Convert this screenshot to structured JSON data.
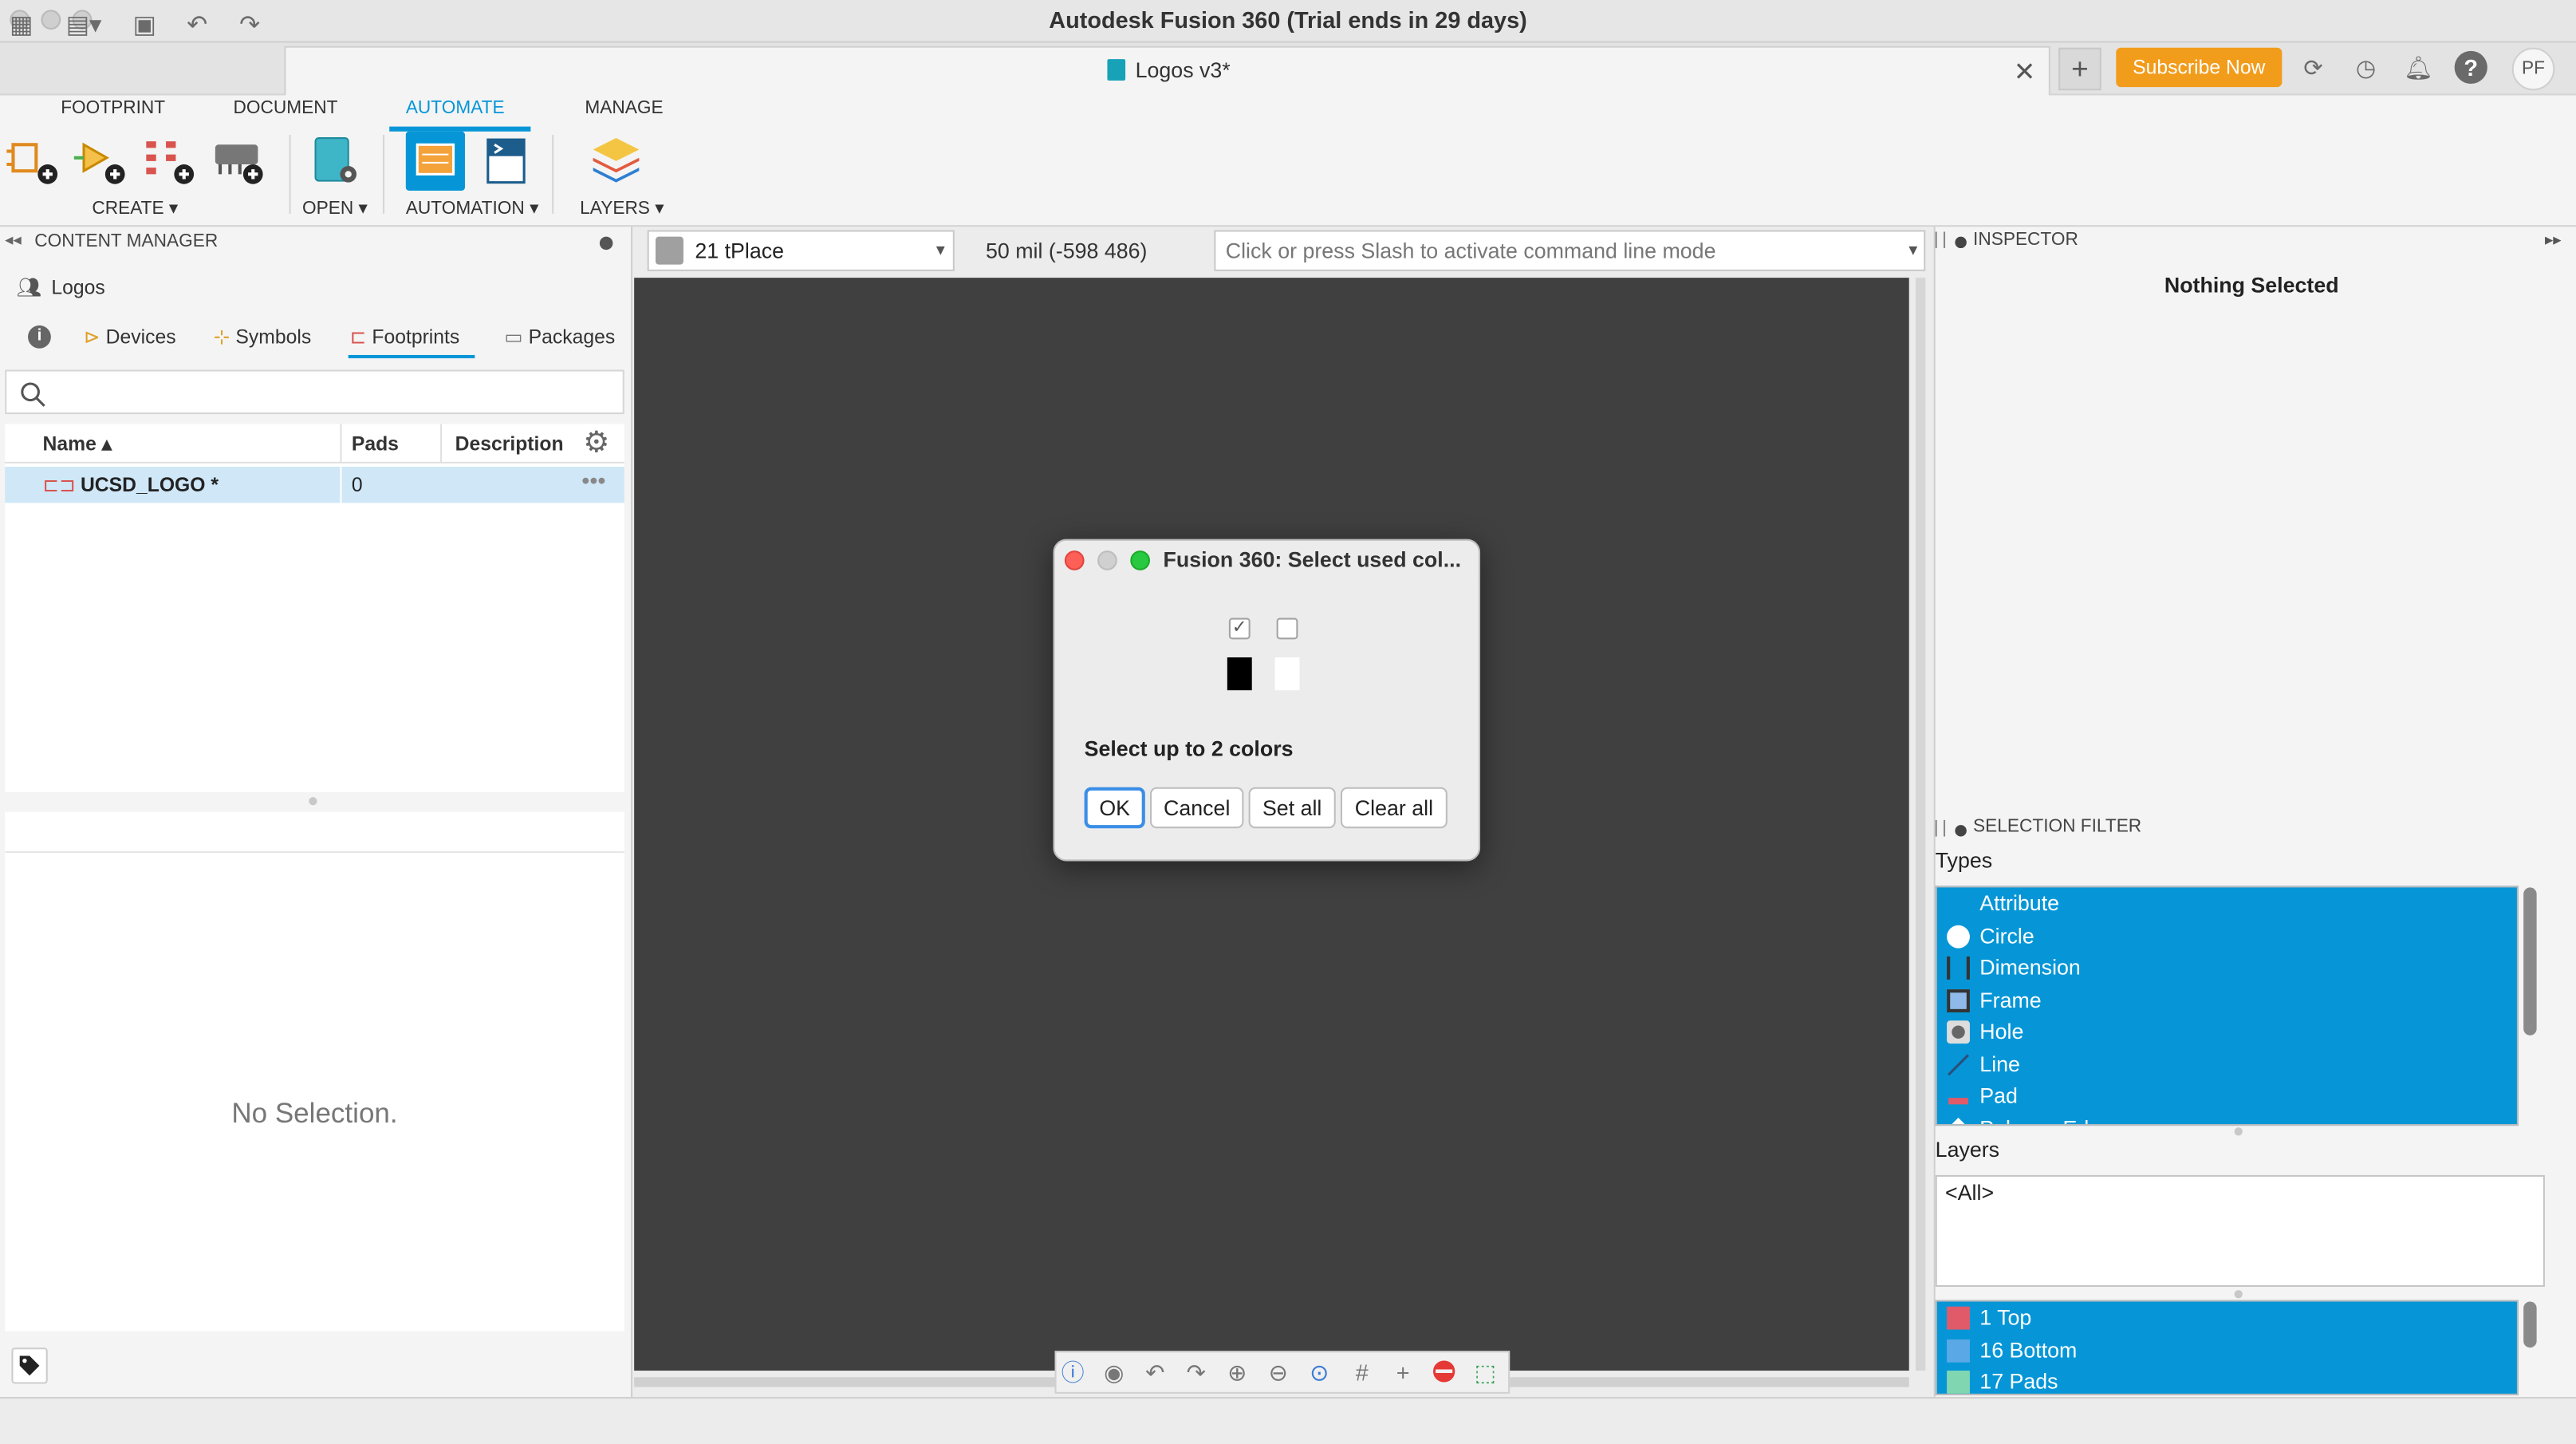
{
  "window": {
    "title": "Autodesk Fusion 360 (Trial ends in 29 days)"
  },
  "tabbar": {
    "document_tab": "Logos v3*",
    "subscribe_label": "Subscribe Now",
    "avatar_initials": "PF"
  },
  "ribbon": {
    "tabs": [
      "FOOTPRINT",
      "DOCUMENT",
      "AUTOMATE",
      "MANAGE"
    ],
    "active_tab": "AUTOMATE",
    "groups": [
      "CREATE ▾",
      "OPEN ▾",
      "AUTOMATION ▾",
      "LAYERS ▾"
    ]
  },
  "content_manager": {
    "header": "CONTENT MANAGER",
    "library": "Logos",
    "tabs": [
      "Devices",
      "Symbols",
      "Footprints",
      "Packages"
    ],
    "active_tab": "Footprints",
    "search_placeholder": "",
    "columns": [
      "Name ▴",
      "Pads",
      "Description"
    ],
    "rows": [
      {
        "name": "UCSD_LOGO *",
        "pads": "0",
        "description": ""
      }
    ],
    "no_selection": "No Selection."
  },
  "canvas_toolbar": {
    "layer": "21 tPlace",
    "layer_color": "#a0a0a0",
    "coordinates": "50 mil (-598 486)",
    "command_placeholder": "Click or press Slash to activate command line mode"
  },
  "dialog": {
    "title": "Fusion 360: Select used col...",
    "colors": [
      {
        "checked": true,
        "color": "#000000"
      },
      {
        "checked": false,
        "color": "#ffffff"
      }
    ],
    "message": "Select up to 2 colors",
    "buttons": {
      "ok": "OK",
      "cancel": "Cancel",
      "set_all": "Set all",
      "clear_all": "Clear all"
    }
  },
  "inspector": {
    "header": "INSPECTOR",
    "nothing_selected": "Nothing Selected"
  },
  "selection_filter": {
    "header": "SELECTION FILTER",
    "types_label": "Types",
    "types": [
      "Attribute",
      "Circle",
      "Dimension",
      "Frame",
      "Hole",
      "Line",
      "Pad",
      "Polygon Edge"
    ],
    "layers_label": "Layers",
    "layers_value": "<All>",
    "layers": [
      {
        "name": "1 Top",
        "color": "#e05a6a"
      },
      {
        "name": "16 Bottom",
        "color": "#5aa8e6"
      },
      {
        "name": "17 Pads",
        "color": "#7fd6b0"
      }
    ]
  },
  "colors": {
    "accent": "#0696d7",
    "subscribe": "#f29c1c",
    "canvas": "#404040"
  }
}
